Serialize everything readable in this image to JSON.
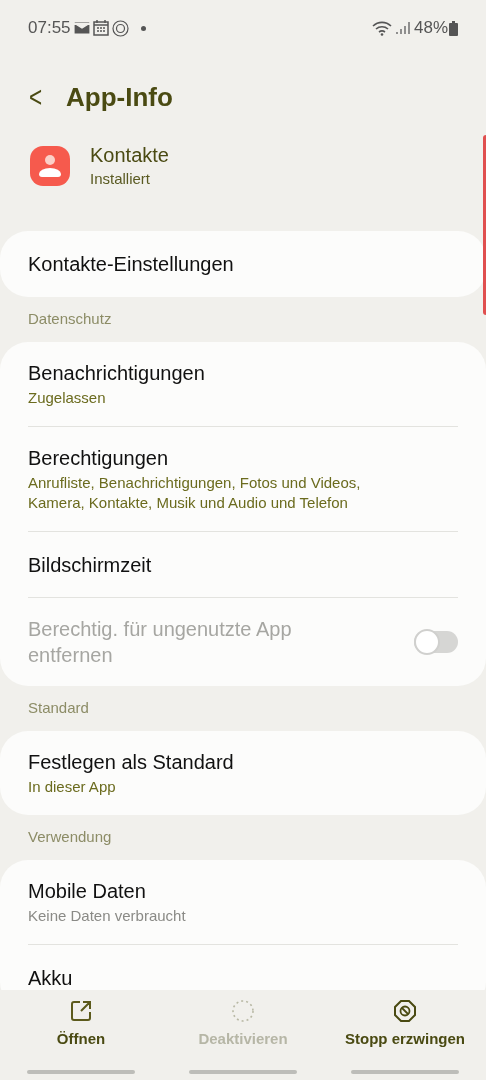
{
  "status_bar": {
    "time": "07:55",
    "battery": "48%"
  },
  "header": {
    "back": "<",
    "title": "App-Info"
  },
  "app": {
    "name": "Kontakte",
    "status": "Installiert"
  },
  "sections": [
    {
      "items": [
        {
          "title": "Kontakte-Einstellungen"
        }
      ]
    },
    {
      "label": "Datenschutz",
      "items": [
        {
          "title": "Benachrichtigungen",
          "subtitle": "Zugelassen",
          "subtitle_muted": false
        },
        {
          "title": "Berechtigungen",
          "subtitle": "Anrufliste, Benachrichtigungen, Fotos und Videos, Kamera, Kontakte, Musik und Audio und Telefon",
          "subtitle_muted": false
        },
        {
          "title": "Bildschirmzeit"
        },
        {
          "title": "Berechtig. für ungenutzte App entfernen",
          "disabled": true,
          "toggle": {
            "on": false
          }
        }
      ]
    },
    {
      "label": "Standard",
      "items": [
        {
          "title": "Festlegen als Standard",
          "subtitle": "In dieser App",
          "subtitle_muted": false
        }
      ]
    },
    {
      "label": "Verwendung",
      "items": [
        {
          "title": "Mobile Daten",
          "subtitle": "Keine Daten verbraucht",
          "subtitle_muted": true
        },
        {
          "title": "Akku"
        }
      ]
    }
  ],
  "actions": [
    {
      "kind": "open",
      "label": "Öffnen",
      "disabled": false
    },
    {
      "kind": "disable",
      "label": "Deaktivieren",
      "disabled": true
    },
    {
      "kind": "stop",
      "label": "Stopp erzwingen",
      "disabled": false
    }
  ]
}
